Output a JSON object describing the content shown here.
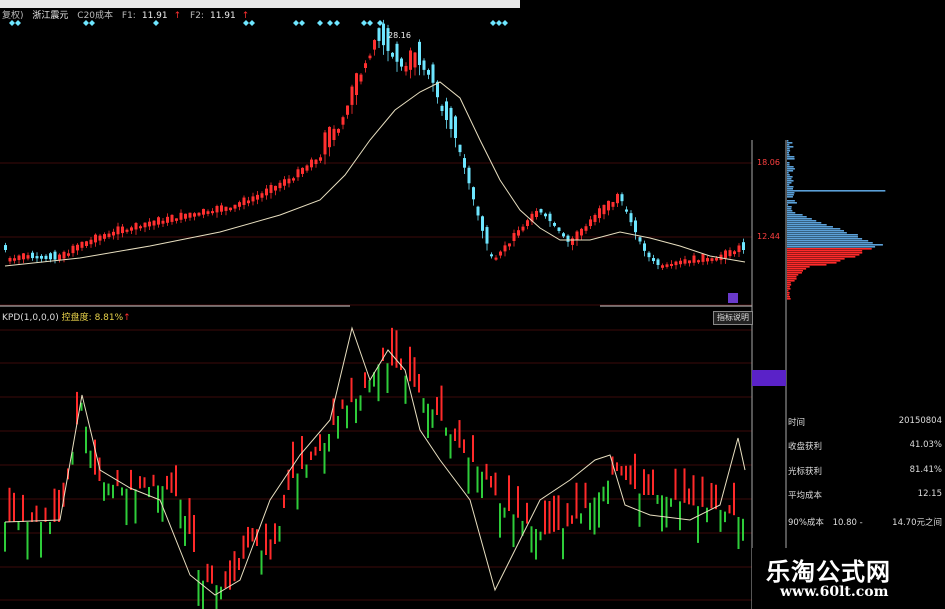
{
  "header": {
    "prefix": "复权)",
    "stock_name": "浙江震元",
    "ma_label": "C20成本",
    "f1_label": "F1:",
    "f1_value": "11.91",
    "f2_label": "F2:",
    "f2_value": "11.91"
  },
  "main_chart": {
    "peak_label": "28.16",
    "price_label_top": "18.06",
    "price_label_bottom": "12.44"
  },
  "indicator": {
    "name": "KPD(1,0,0,0)",
    "metric_label": "控盘度:",
    "metric_value": "8.81%",
    "explain_button": "指标说明"
  },
  "right_panel": {
    "rows": [
      {
        "key": "时间",
        "value": "20150804"
      },
      {
        "key": "收盘获利",
        "value": "41.03%"
      },
      {
        "key": "光标获利",
        "value": "81.41%"
      },
      {
        "key": "平均成本",
        "value": "12.15"
      }
    ],
    "cost_label": "90%成本",
    "cost_low": "10.80",
    "cost_sep": "-",
    "cost_high": "14.70元之间"
  },
  "watermark": {
    "name": "乐淘公式网",
    "url": "www.60lt.com"
  },
  "colors": {
    "up": "#ff3030",
    "down": "#6ee6ff",
    "ma": "#e8dfc0",
    "grid": "#7a1515",
    "ind_up": "#ff2a2a",
    "ind_down": "#2ecc3a"
  }
}
